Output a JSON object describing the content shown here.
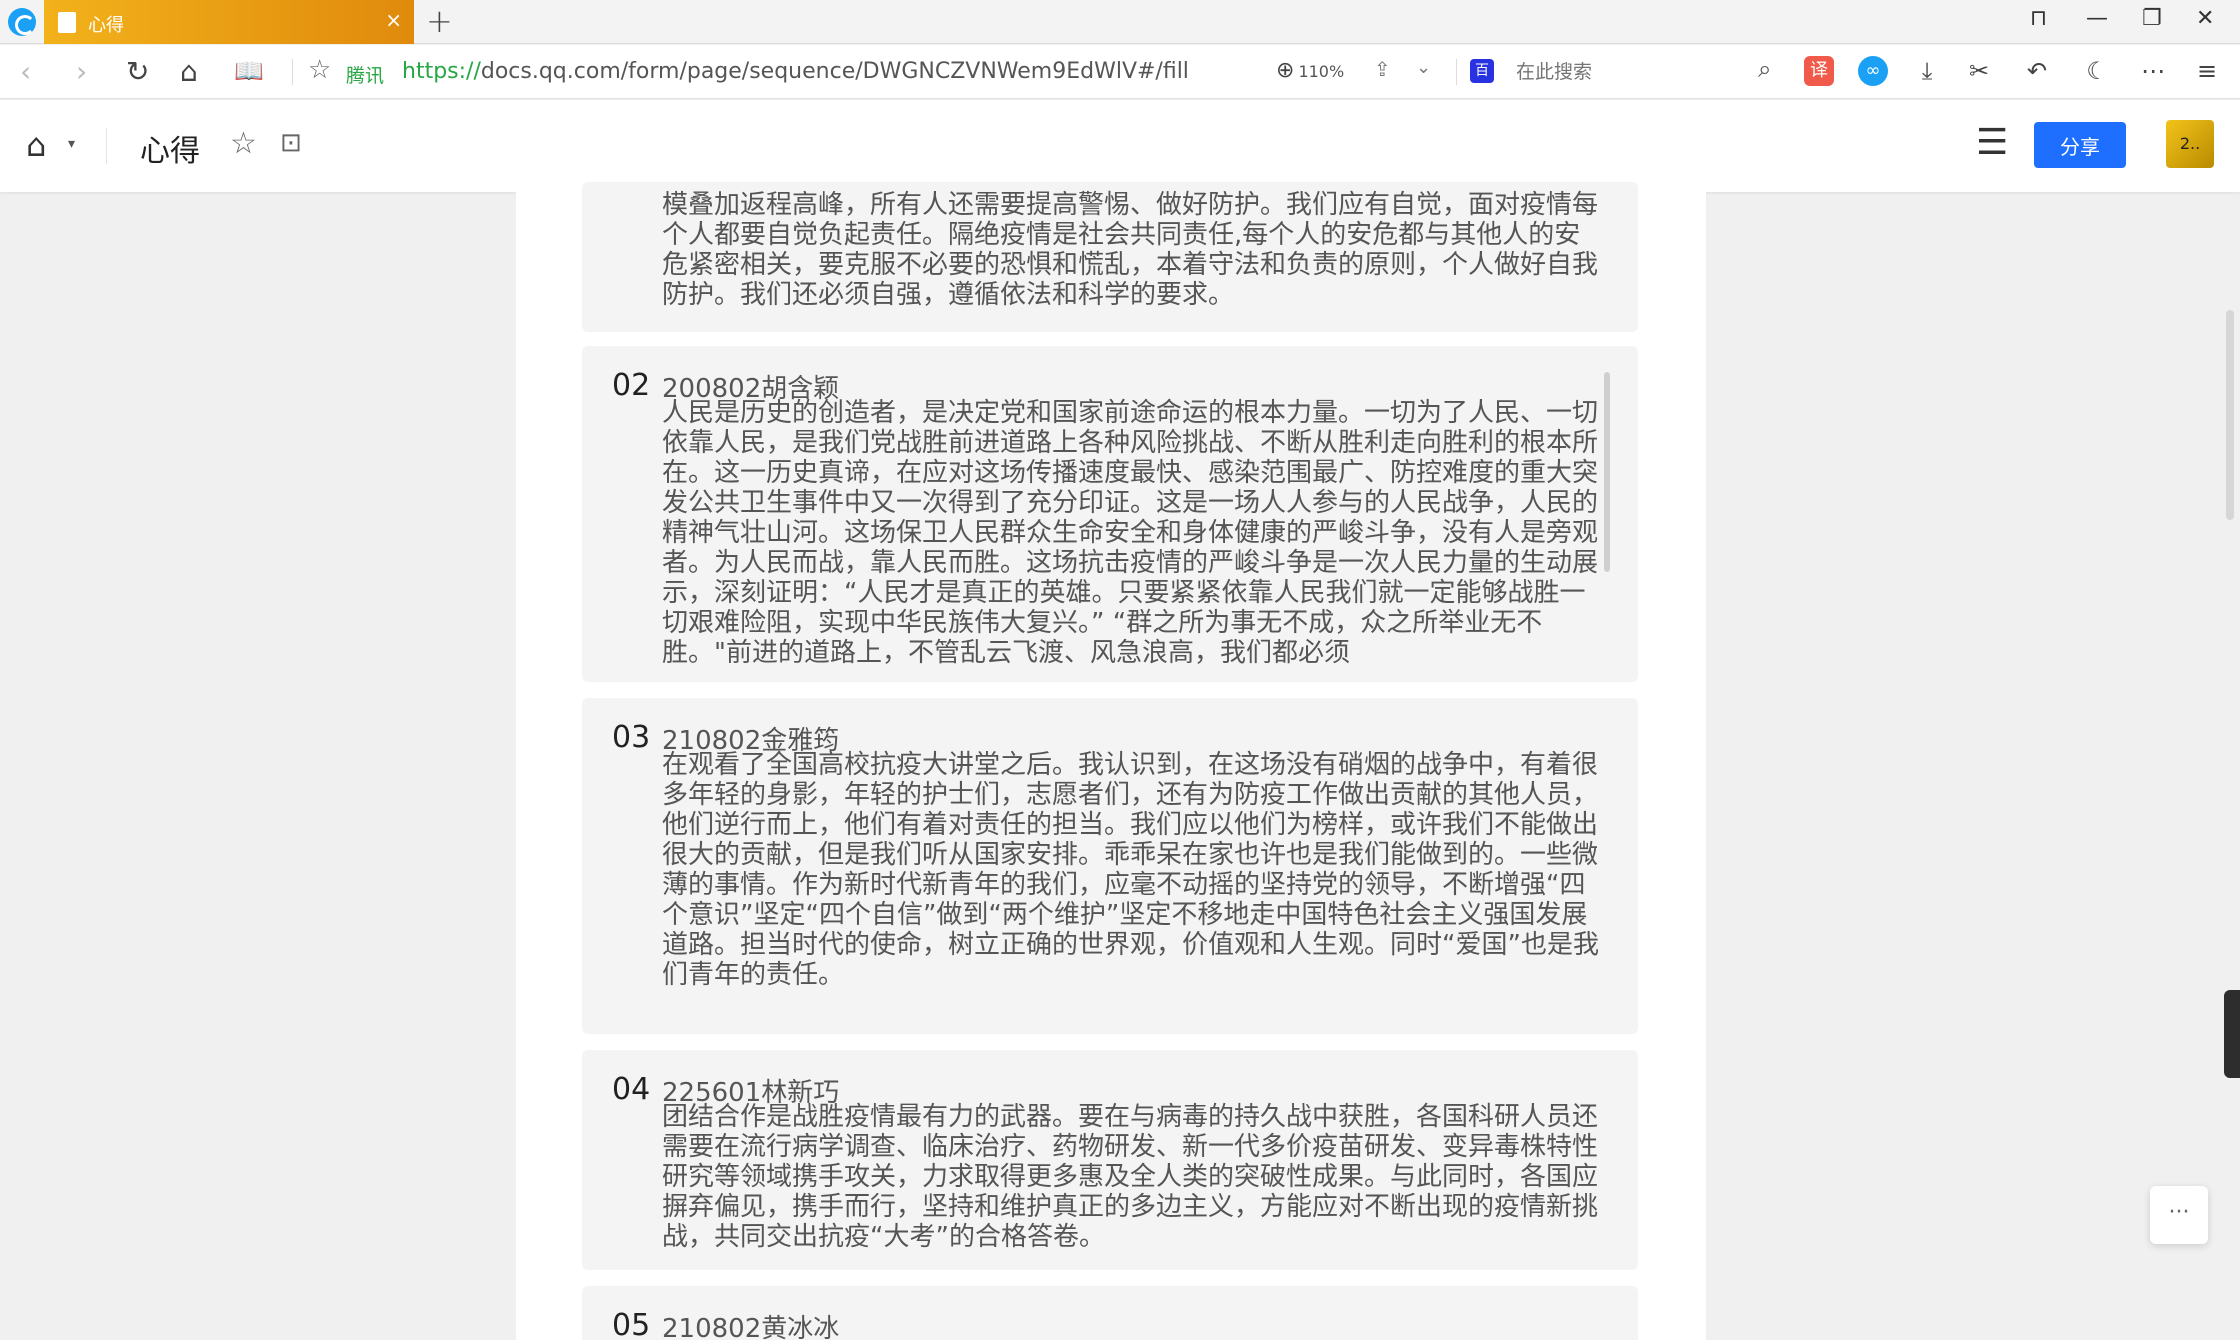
{
  "browser": {
    "tab_title": "心得",
    "tab_close": "×",
    "new_tab": "+",
    "url_label": "腾讯",
    "url_protocol": "https://",
    "url_rest": "docs.qq.com/form/page/sequence/DWGNCZVNWem9EdWlV#/fill",
    "zoom": "110%",
    "search_engine": "百",
    "search_placeholder": "在此搜索",
    "icons": {
      "back": "‹",
      "forward": "›",
      "reload": "↻",
      "home": "⌂",
      "reader": "📖",
      "star": "☆",
      "zoom": "⊕",
      "share": "⇪",
      "chevron": "⌄",
      "search": "⌕",
      "translate": "译",
      "infinity": "∞",
      "download": "⤓",
      "scissors": "✂",
      "undo": "↶",
      "moon": "☾",
      "more": "⋯",
      "menu": "≡",
      "shirt": "⊓",
      "minimize": "—",
      "restore": "❐",
      "close": "✕"
    }
  },
  "doc": {
    "title": "心得",
    "share_label": "分享",
    "avatar_text": "2..",
    "icons": {
      "home": "⌂",
      "caret": "▾",
      "star": "☆",
      "add": "⊡",
      "menu": "☰"
    }
  },
  "answers": [
    {
      "num": "",
      "name": "",
      "text": "模叠加返程高峰，所有人还需要提高警惕、做好防护。我们应有自觉，面对疫情每个人都要自觉负起责任。隔绝疫情是社会共同责任,每个人的安危都与其他人的安危紧密相关，要克服不必要的恐惧和慌乱，本着守法和负责的原则，个人做好自我防护。我们还必须自强，遵循依法和科学的要求。"
    },
    {
      "num": "02",
      "name": "200802胡含颖",
      "text": "人民是历史的创造者，是决定党和国家前途命运的根本力量。一切为了人民、一切依靠人民，是我们党战胜前进道路上各种风险挑战、不断从胜利走向胜利的根本所在。这一历史真谛，在应对这场传播速度最快、感染范围最广、防控难度的重大突发公共卫生事件中又一次得到了充分印证。这是一场人人参与的人民战争，人民的精神气壮山河。这场保卫人民群众生命安全和身体健康的严峻斗争，没有人是旁观者。为人民而战，靠人民而胜。这场抗击疫情的严峻斗争是一次人民力量的生动展示，深刻证明：“人民才是真正的英雄。只要紧紧依靠人民我们就一定能够战胜一切艰难险阻，实现中华民族伟大复兴。” “群之所为事无不成，众之所举业无不胜。\"前进的道路上，不管乱云飞渡、风急浪高，我们都必须"
    },
    {
      "num": "03",
      "name": "210802金雅筠",
      "text": "在观看了全国高校抗疫大讲堂之后。我认识到，在这场没有硝烟的战争中，有着很多年轻的身影，年轻的护士们，志愿者们，还有为防疫工作做出贡献的其他人员，他们逆行而上，他们有着对责任的担当。我们应以他们为榜样，或许我们不能做出很大的贡献，但是我们听从国家安排。乖乖呆在家也许也是我们能做到的。一些微薄的事情。作为新时代新青年的我们，应毫不动摇的坚持党的领导，不断增强“四个意识”坚定“四个自信”做到“两个维护”坚定不移地走中国特色社会主义强国发展道路。担当时代的使命，树立正确的世界观，价值观和人生观。同时“爱国”也是我们青年的责任。"
    },
    {
      "num": "04",
      "name": "225601林新巧",
      "text": "团结合作是战胜疫情最有力的武器。要在与病毒的持久战中获胜，各国科研人员还需要在流行病学调查、临床治疗、药物研发、新一代多价疫苗研发、变异毒株特性研究等领域携手攻关，力求取得更多惠及全人类的突破性成果。与此同时，各国应摒弃偏见，携手而行，坚持和维护真正的多边主义，方能应对不断出现的疫情新挑战，共同交出抗疫“大考”的合格答卷。"
    },
    {
      "num": "05",
      "name": "210802黄冰冰",
      "text": ""
    }
  ],
  "float_more": "···"
}
